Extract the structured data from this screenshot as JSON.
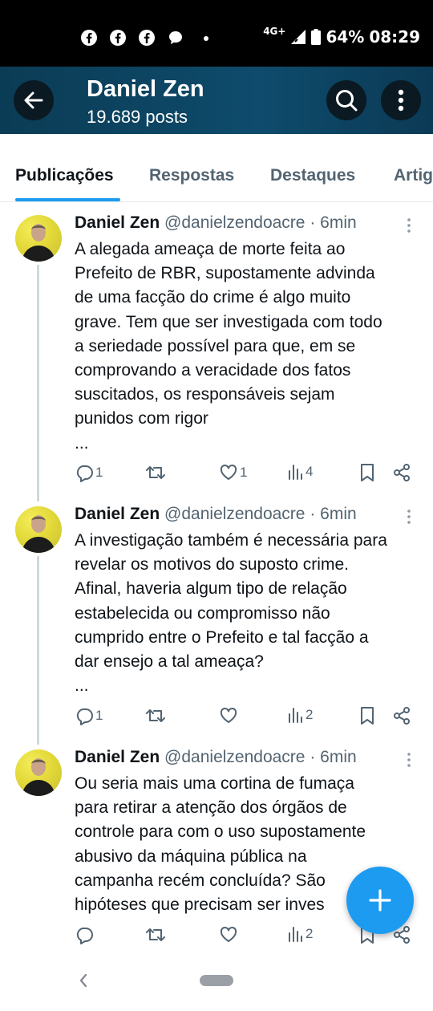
{
  "status_bar": {
    "notification_icons": [
      "facebook-icon",
      "facebook-icon",
      "facebook-icon",
      "chat-icon"
    ],
    "network": "4G+",
    "battery": "64%",
    "time": "08:29"
  },
  "header": {
    "title": "Daniel Zen",
    "subtitle": "19.689 posts"
  },
  "tabs": [
    {
      "label": "Publicações",
      "active": true
    },
    {
      "label": "Respostas",
      "active": false
    },
    {
      "label": "Destaques",
      "active": false
    },
    {
      "label": "Artig",
      "active": false
    }
  ],
  "tweets": [
    {
      "name": "Daniel Zen",
      "handle": "@danielzendoacre",
      "sep": "·",
      "time": "6min",
      "lines": [
        "A alegada ameaça de morte feita ao",
        "Prefeito de RBR, supostamente advinda",
        "de uma facção do crime é algo muito",
        "grave. Tem que ser investigada com todo",
        "a seriedade possível para que, em se",
        "comprovando a veracidade dos fatos",
        "suscitados, os responsáveis sejam",
        "punidos com rigor",
        "..."
      ],
      "replies": "1",
      "reposts": "",
      "likes": "1",
      "views": "4"
    },
    {
      "name": "Daniel Zen",
      "handle": "@danielzendoacre",
      "sep": "·",
      "time": "6min",
      "lines": [
        "A investigação também é necessária para",
        "revelar os motivos do suposto crime.",
        "Afinal, haveria algum tipo de relação",
        "estabelecida ou compromisso não",
        "cumprido entre o Prefeito e tal facção a",
        "dar ensejo a tal ameaça?",
        "..."
      ],
      "replies": "1",
      "reposts": "",
      "likes": "",
      "views": "2"
    },
    {
      "name": "Daniel Zen",
      "handle": "@danielzendoacre",
      "sep": "·",
      "time": "6min",
      "lines": [
        "Ou seria mais uma cortina de fumaça",
        "para retirar a atenção dos órgãos de",
        "controle para com o uso supostamente",
        "abusivo da máquina pública na",
        "campanha recém concluída? São",
        "hipóteses que precisam ser inves"
      ],
      "replies": "",
      "reposts": "",
      "likes": "",
      "views": "2"
    }
  ],
  "colors": {
    "header_bg": "#0e4b6c",
    "accent": "#1d9bf0",
    "muted_text": "#536471"
  }
}
